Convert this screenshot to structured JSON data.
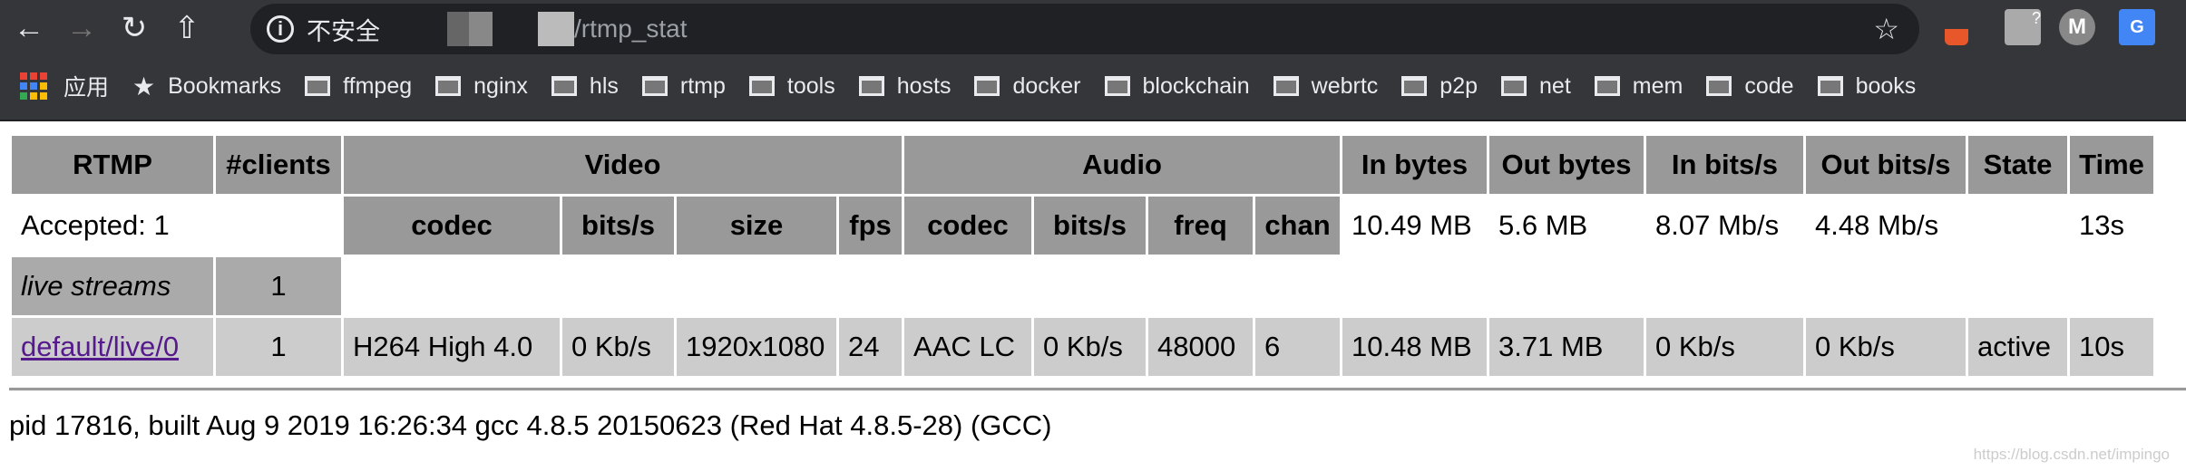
{
  "browser": {
    "nav_icons": [
      "back-arrow-icon",
      "forward-arrow-icon",
      "reload-icon",
      "home-icon"
    ],
    "security_label": "不安全",
    "url_visible": "/rtmp_stat",
    "apps_label": "应用",
    "bookmarks": [
      "Bookmarks",
      "ffmpeg",
      "nginx",
      "hls",
      "rtmp",
      "tools",
      "hosts",
      "docker",
      "blockchain",
      "webrtc",
      "p2p",
      "net",
      "mem",
      "code",
      "books"
    ],
    "extension_badge": "?",
    "extension_m": "M",
    "extension_g": "G"
  },
  "table": {
    "header": {
      "rtmp": "RTMP",
      "clients": "#clients",
      "video": "Video",
      "audio": "Audio",
      "in_bytes": "In bytes",
      "out_bytes": "Out bytes",
      "in_bits": "In bits/s",
      "out_bits": "Out bits/s",
      "state": "State",
      "time": "Time"
    },
    "subheader": {
      "accepted": "Accepted: 1",
      "video": [
        "codec",
        "bits/s",
        "size",
        "fps"
      ],
      "audio": [
        "codec",
        "bits/s",
        "freq",
        "chan"
      ],
      "in_bytes": "10.49 MB",
      "out_bytes": "5.6 MB",
      "in_bits": "8.07 Mb/s",
      "out_bits": "4.48 Mb/s",
      "state": "",
      "time": "13s"
    },
    "group": {
      "name": "live streams",
      "count": "1"
    },
    "stream": {
      "name": "default/live/0",
      "clients": "1",
      "video_codec": "H264 High 4.0",
      "video_bits": "0 Kb/s",
      "video_size": "1920x1080",
      "video_fps": "24",
      "audio_codec": "AAC LC",
      "audio_bits": "0 Kb/s",
      "audio_freq": "48000",
      "audio_chan": "6",
      "in_bytes": "10.48 MB",
      "out_bytes": "3.71 MB",
      "in_bits": "0 Kb/s",
      "out_bits": "0 Kb/s",
      "state": "active",
      "time": "10s"
    }
  },
  "footer": "pid 17816, built Aug 9 2019 16:26:34 gcc 4.8.5 20150623 (Red Hat 4.8.5-28) (GCC)",
  "watermark": "https://blog.csdn.net/impingo"
}
